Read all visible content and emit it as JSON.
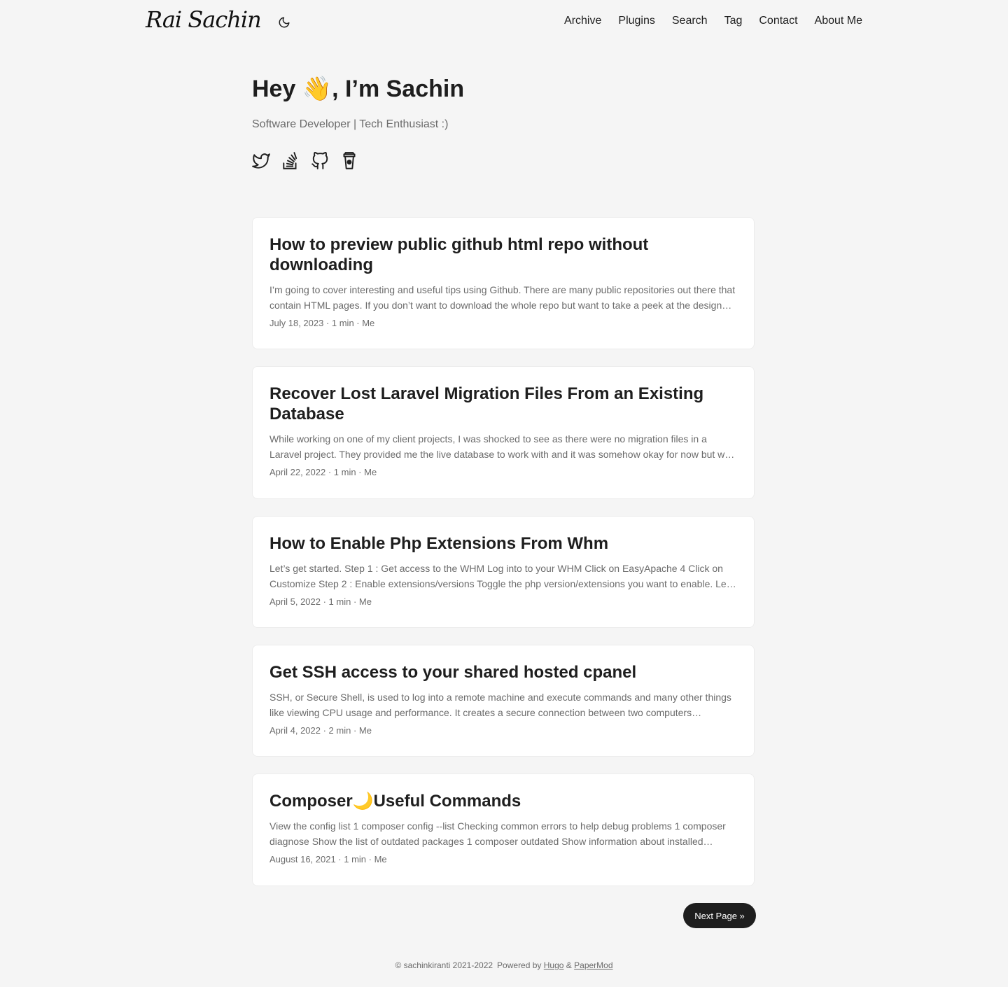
{
  "header": {
    "logo_text": "Rai Sachin",
    "theme_icon": "moon-icon",
    "nav": [
      "Archive",
      "Plugins",
      "Search",
      "Tag",
      "Contact",
      "About Me"
    ]
  },
  "hero": {
    "title": "Hey 👋, I’m Sachin",
    "subtitle": "Software Developer | Tech Enthusiast :)",
    "social_icons": [
      "twitter-icon",
      "stackoverflow-icon",
      "github-icon",
      "buymeacoffee-icon"
    ]
  },
  "posts": [
    {
      "title": "How to preview public github html repo without downloading",
      "summary": "I’m going to cover interesting and useful tips using Github. There are many public repositories out there that contain HTML pages. If you don’t want to download the whole repo but want to take a peek at the design…",
      "meta": "July 18, 2023 · 1 min · Me"
    },
    {
      "title": "Recover Lost Laravel Migration Files From an Existing Database",
      "summary": "While working on one of my client projects, I was shocked to see as there were no migration files in a Laravel project. They provided me the live database to work with and it was somehow okay for now but w…",
      "meta": "April 22, 2022 · 1 min · Me"
    },
    {
      "title": "How to Enable Php Extensions From Whm",
      "summary": "Let’s get started. Step 1 : Get access to the WHM Log into to your WHM Click on EasyApache 4 Click on Customize Step 2 : Enable extensions/versions Toggle the php version/extensions you want to enable. Le…",
      "meta": "April 5, 2022 · 1 min · Me"
    },
    {
      "title": "Get SSH access to your shared hosted cpanel",
      "summary": "SSH, or Secure Shell, is used to log into a remote machine and execute commands and many other things like viewing CPU usage and performance. It creates a secure connection between two computers through…",
      "meta": "April 4, 2022 · 2 min · Me"
    },
    {
      "title": "Composer🌙Useful Commands",
      "summary": "View the config list 1 composer config --list Checking common errors to help debug problems 1 composer diagnose Show the list of outdated packages 1 composer outdated Show information about installed…",
      "meta": "August 16, 2021 · 1 min · Me"
    }
  ],
  "pagination": {
    "next_label": "Next Page »"
  },
  "footer": {
    "copyright": "© sachinkiranti 2021-2022",
    "powered_by": "Powered by",
    "hugo": "Hugo",
    "amp": "&",
    "papermod": "PaperMod"
  }
}
